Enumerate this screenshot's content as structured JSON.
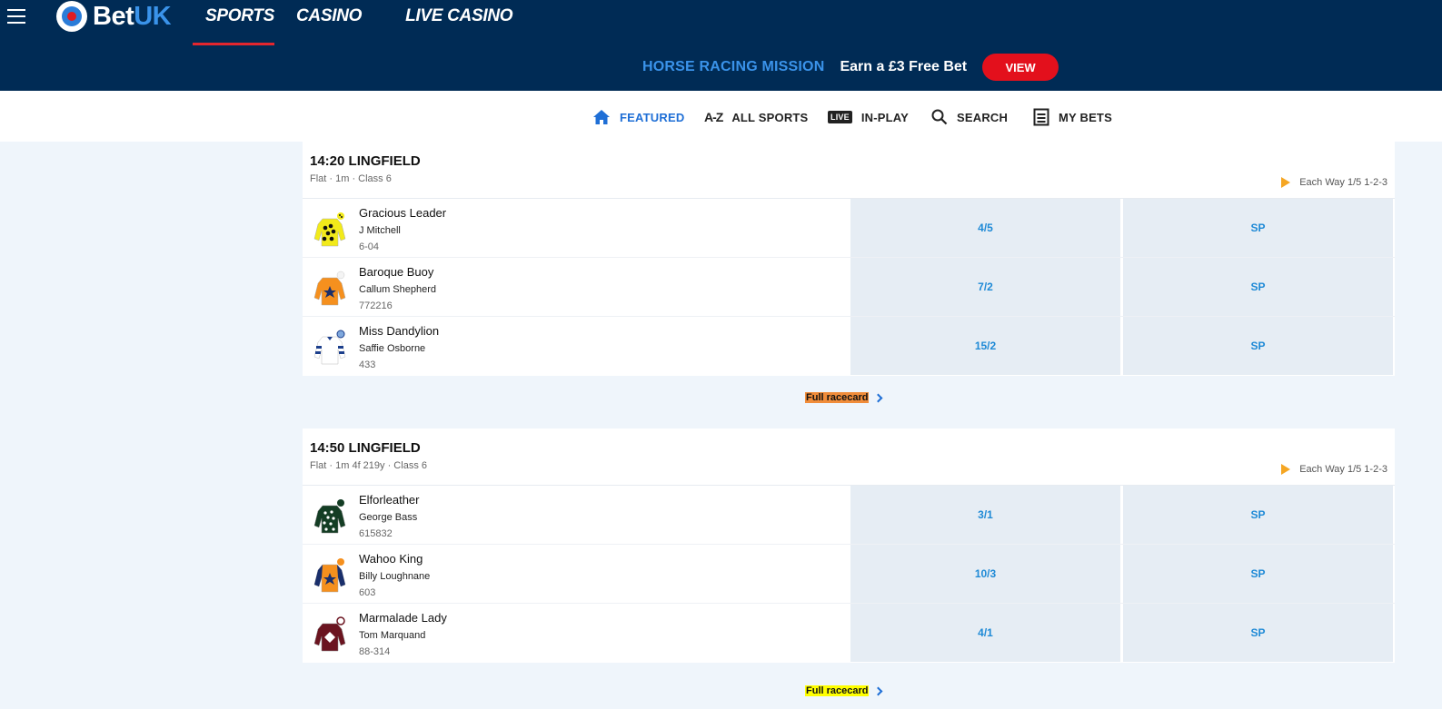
{
  "header": {
    "logo_bet": "Bet",
    "logo_uk": "UK",
    "tabs": [
      {
        "label": "SPORTS"
      },
      {
        "label": "CASINO"
      },
      {
        "label": "LIVE CASINO"
      }
    ],
    "promo": {
      "title": "HORSE RACING MISSION",
      "text": "Earn a £3 Free Bet",
      "button": "VIEW"
    }
  },
  "subnav": {
    "items": [
      {
        "label": "FEATURED",
        "icon": "home-icon"
      },
      {
        "label": "ALL SPORTS",
        "icon_text": "A-Z"
      },
      {
        "label": "IN-PLAY",
        "icon_text": "LIVE"
      },
      {
        "label": "SEARCH",
        "icon": "search-icon"
      },
      {
        "label": "MY BETS",
        "icon": "betslip-icon"
      }
    ]
  },
  "races": [
    {
      "title": "14:20 LINGFIELD",
      "meta": "Flat · 1m · Class 6",
      "each_way": "Each Way 1/5 1-2-3",
      "link": "Full racecard",
      "runners": [
        {
          "horse": "Gracious Leader",
          "jockey": "J Mitchell",
          "form": "6-04",
          "price": "4/5",
          "sp": "SP",
          "silk": "yellow-black-spots"
        },
        {
          "horse": "Baroque Buoy",
          "jockey": "Callum Shepherd",
          "form": "772216",
          "price": "7/2",
          "sp": "SP",
          "silk": "orange-blue-star"
        },
        {
          "horse": "Miss Dandylion",
          "jockey": "Saffie Osborne",
          "form": "433",
          "price": "15/2",
          "sp": "SP",
          "silk": "white-blue-hoops"
        }
      ]
    },
    {
      "title": "14:50 LINGFIELD",
      "meta": "Flat · 1m 4f 219y · Class 6",
      "each_way": "Each Way 1/5 1-2-3",
      "link": "Full racecard",
      "runners": [
        {
          "horse": "Elforleather",
          "jockey": "George Bass",
          "form": "615832",
          "price": "3/1",
          "sp": "SP",
          "silk": "darkgreen-white-spots"
        },
        {
          "horse": "Wahoo King",
          "jockey": "Billy Loughnane",
          "form": "603",
          "price": "10/3",
          "sp": "SP",
          "silk": "orange-navy-star"
        },
        {
          "horse": "Marmalade Lady",
          "jockey": "Tom Marquand",
          "form": "88-314",
          "price": "4/1",
          "sp": "SP",
          "silk": "maroon-white-diamond"
        }
      ]
    }
  ],
  "colors": {
    "header_bg": "#002b55",
    "accent_red": "#e3101c",
    "accent_blue": "#3a93ea",
    "odds_text": "#1f8ad6",
    "odds_bg": "#e6edf4",
    "page_bg": "#eff5fb"
  }
}
